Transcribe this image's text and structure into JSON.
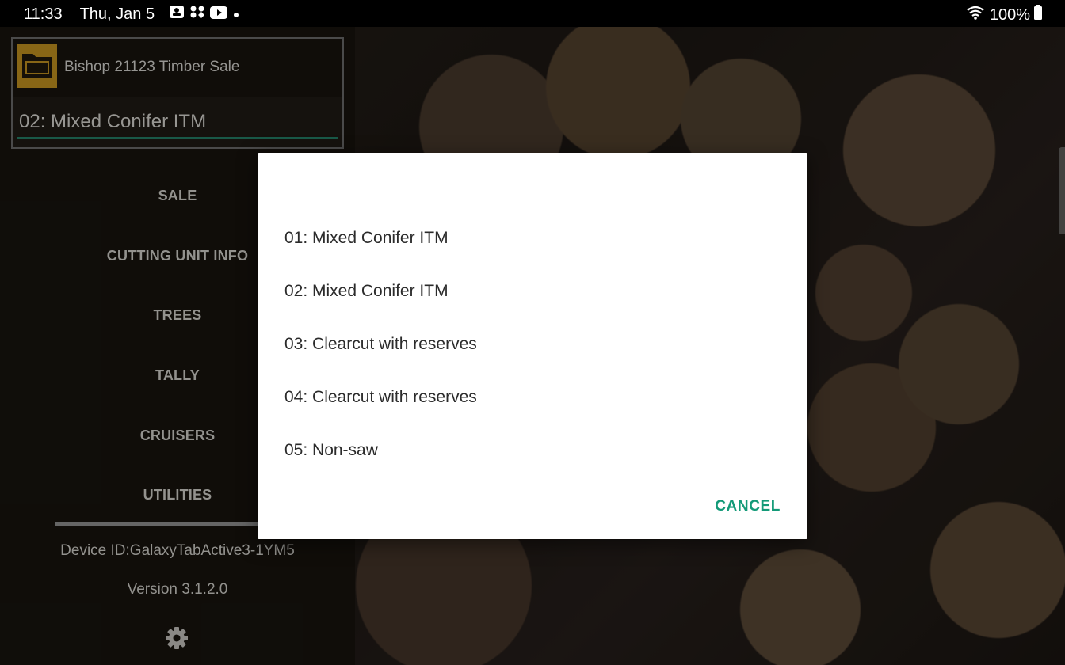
{
  "status_bar": {
    "time": "11:33",
    "date": "Thu, Jan 5",
    "battery_text": "100%",
    "notification_icons": [
      "notification-app-icon",
      "apps-icon",
      "youtube-icon",
      "dot-icon"
    ]
  },
  "sidebar": {
    "sale_name": "Bishop 21123 Timber Sale",
    "cutting_unit": "02: Mixed Conifer ITM",
    "nav": [
      {
        "label": "SALE"
      },
      {
        "label": "CUTTING UNIT INFO"
      },
      {
        "label": "TREES"
      },
      {
        "label": "TALLY"
      },
      {
        "label": "CRUISERS"
      },
      {
        "label": "UTILITIES"
      }
    ],
    "device_id": "Device ID:GalaxyTabActive3-1YM5",
    "version": "Version 3.1.2.0"
  },
  "dialog": {
    "options": [
      "01: Mixed Conifer ITM",
      "02: Mixed Conifer ITM",
      "03: Clearcut with reserves",
      "04: Clearcut with reserves",
      "05: Non-saw"
    ],
    "cancel_label": "CANCEL"
  },
  "colors": {
    "accent": "#139a78",
    "underline": "#1f6d58",
    "folder": "#a77d1b",
    "sidebar_bg": "#14110c"
  }
}
